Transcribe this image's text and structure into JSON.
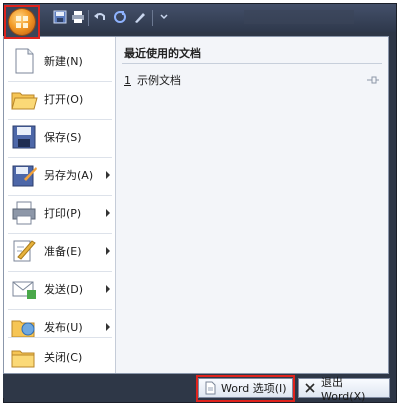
{
  "menu": {
    "items": [
      {
        "label": "新建(N)",
        "icon": "new-document-icon",
        "has_submenu": false
      },
      {
        "label": "打开(O)",
        "icon": "open-folder-icon",
        "has_submenu": false
      },
      {
        "label": "保存(S)",
        "icon": "save-floppy-icon",
        "has_submenu": false
      },
      {
        "label": "另存为(A)",
        "icon": "save-as-icon",
        "has_submenu": true
      },
      {
        "label": "打印(P)",
        "icon": "printer-icon",
        "has_submenu": true
      },
      {
        "label": "准备(E)",
        "icon": "prepare-icon",
        "has_submenu": true
      },
      {
        "label": "发送(D)",
        "icon": "send-icon",
        "has_submenu": true
      },
      {
        "label": "发布(U)",
        "icon": "publish-icon",
        "has_submenu": true
      },
      {
        "label": "关闭(C)",
        "icon": "close-folder-icon",
        "has_submenu": false
      }
    ]
  },
  "recent": {
    "title": "最近使用的文档",
    "items": [
      {
        "number": "1",
        "name": "示例文档"
      }
    ]
  },
  "bottom": {
    "options_label": "Word 选项(I)",
    "exit_label": "退出 Word(X)"
  },
  "colors": {
    "highlight_border": "#e0231d",
    "office_orb": "#f39b26",
    "title_bar": "#2e3747"
  }
}
